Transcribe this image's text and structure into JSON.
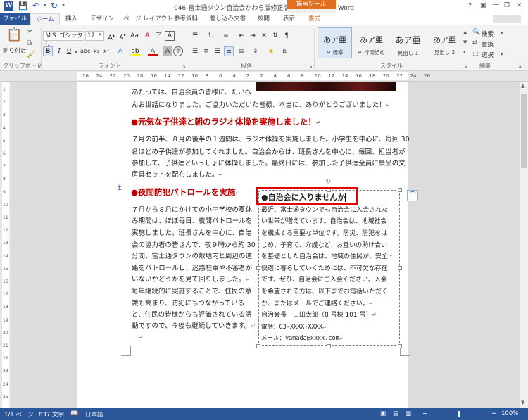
{
  "window": {
    "title": "046-富士通タウン自治会かわら版修正版-beforer.docx - Word",
    "context_tab_header": "描画ツール",
    "help": "?",
    "min": "—",
    "restore": "❐",
    "close": "✕"
  },
  "tabs": {
    "file": "ファイル",
    "home": "ホーム",
    "insert": "挿入",
    "design": "デザイン",
    "layout": "ページ レイアウト",
    "references": "参考資料",
    "mailings": "差し込み文書",
    "review": "校閲",
    "view": "表示",
    "format": "書式"
  },
  "ribbon": {
    "clipboard": {
      "paste": "貼り付け",
      "group": "クリップボード"
    },
    "font": {
      "name": "ＭＳ ゴシック (.",
      "size": "12",
      "group": "フォント"
    },
    "paragraph": {
      "group": "段落"
    },
    "styles": {
      "group": "スタイル",
      "items": [
        {
          "sample": "あア亜",
          "label": "↵ 標準"
        },
        {
          "sample": "あア亜",
          "label": "↵ 行間詰め"
        },
        {
          "sample": "あア亜",
          "label": "見出し 1"
        },
        {
          "sample": "あア亜",
          "label": "見出し 2"
        }
      ]
    },
    "editing": {
      "find": "検索",
      "replace": "置換",
      "select": "選択",
      "group": "編集"
    }
  },
  "ruler": {
    "numbers": [
      "26",
      "24",
      "22",
      "20",
      "18",
      "16",
      "14",
      "12",
      "10",
      "8",
      "6",
      "4",
      "2",
      "2",
      "4",
      "6",
      "8",
      "10",
      "12",
      "14",
      "16",
      "18",
      "20",
      "22",
      "24",
      "26"
    ],
    "vnumbers": [
      "1",
      "2",
      "3",
      "4",
      "5",
      "6",
      "7",
      "8",
      "9",
      "10",
      "11",
      "12",
      "13",
      "14",
      "15",
      "16",
      "17",
      "18",
      "19",
      "20",
      "21",
      "22",
      "23",
      "24",
      "25"
    ]
  },
  "document": {
    "intro_lines": [
      "あたっては、自治会員の皆様に、たいへ",
      "んお世話になりました。ご協力いただいた皆様、本当に、ありがとうございました！"
    ],
    "heading1": "●元気な子供達と朝のラジオ体操を実施しました！",
    "para1": [
      "７月の前半、８月の後半の１週間は、ラジオ体操を実施しました。小学生を中心に、毎回 30",
      "名ほどの子供達が参加してくれました。自治会からは、班長さんを中心に、毎回、担当者が",
      "参加して、子供達といっしょに体操しました。最終日には、参加した子供達全員に景品の文",
      "房具セットを配布しました。"
    ],
    "heading2": "●夜間防犯パトロールを実施",
    "para2": [
      "７月から８月にかけての小中学校の夏休",
      "み期間は、ほぼ毎日、夜間パトロールを",
      "実施しました。班長さんを中心に、自治",
      "会の協力者の皆さんで、夜９時から約 30",
      "分間、富士通タウンの敷地内と周辺の道",
      "路をパトロールし、迷惑駐車や不審者が",
      "いないかどうかを見て回りしました。",
      "毎年継続的に実施することで、住民の意",
      "識も高まり、防犯にもつながっている",
      "と、住民の皆様からも評価されている活",
      "動ですので、今後も継続していきます。"
    ]
  },
  "textbox": {
    "title": "●自治会に入りませんか",
    "lines": [
      "最近、富士通タウンでも自治会に入会されな",
      "い世帯が増えています。自治会は、地域社会",
      "を構成する重要な単位です。防災、防犯をは",
      "じめ、子育て、介護など、お互いの助け合い",
      "を基礎とした自治会は、地域の住民が、安全・",
      "快適に暮らしていくためには、不可欠な存在",
      "です。ぜひ、自治会にご入会ください。入会",
      "を希望される方は、以下までお電話いただく",
      "か、またはメールでご連絡ください。",
      "自治会長　山田太郎（8 号棟 101 号）",
      "電話：03-XXXX-XXXX",
      "メール：yamada@xxxx.com"
    ]
  },
  "status": {
    "page": "1/1 ページ",
    "words": "837 文字",
    "lang": "日本語",
    "zoom": "100%"
  },
  "colors": {
    "accent": "#2b579a",
    "heading": "#c00000",
    "drawing_tools": "#e07020",
    "highlight": "#e00000"
  }
}
